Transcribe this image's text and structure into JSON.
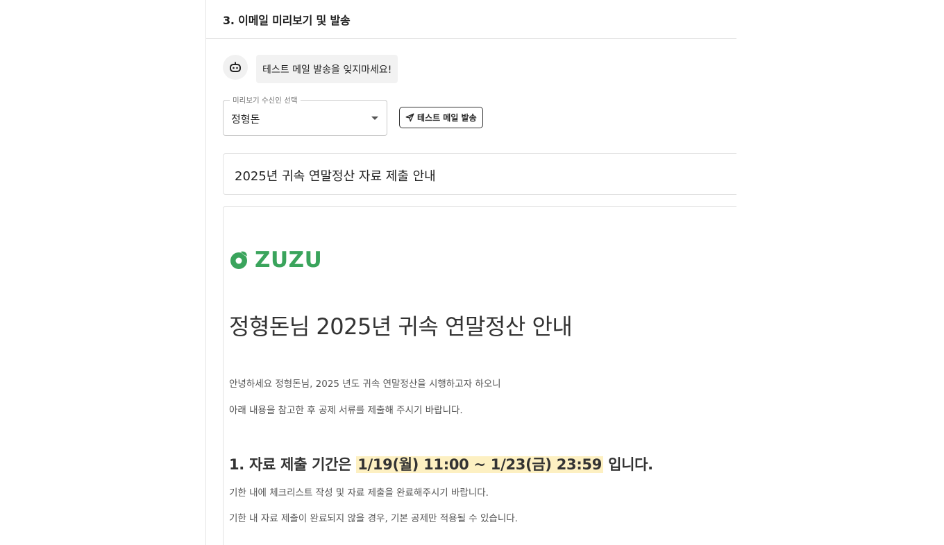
{
  "section": {
    "title": "3. 이메일 미리보기 및 발송"
  },
  "assistant": {
    "icon": "robot-icon",
    "message": "테스트 메일 발송을 잊지마세요!"
  },
  "recipient_select": {
    "label": "미리보기 수신인 선택",
    "value": "정형돈"
  },
  "test_send_button": {
    "icon": "send-icon",
    "label": "테스트 메일 발송"
  },
  "email": {
    "subject": "2025년 귀속 연말정산 자료 제출 안내",
    "logo_text": "ZUZU",
    "brand_color": "#3aa45c",
    "title": "정형돈님 2025년 귀속 연말정산 안내",
    "greeting_line1": "안녕하세요 정형돈님, 2025 년도 귀속 연말정산을 시행하고자 하오니",
    "greeting_line2": "아래 내용을 참고한 후 공제 서류를 제출해 주시기 바랍니다.",
    "section1": {
      "prefix": "1. 자료 제출 기간은 ",
      "period": "1/19(월) 11:00 ~ 1/23(금) 23:59",
      "suffix": " 입니다.",
      "highlight_color": "#fdf0c2"
    },
    "note1": "기한 내에 체크리스트 작성 및 자료 제출을 완료해주시기 바랍니다.",
    "note2": "기한 내 자료 제출이 완료되지 않을 경우, 기본 공제만 적용될 수 있습니다."
  }
}
